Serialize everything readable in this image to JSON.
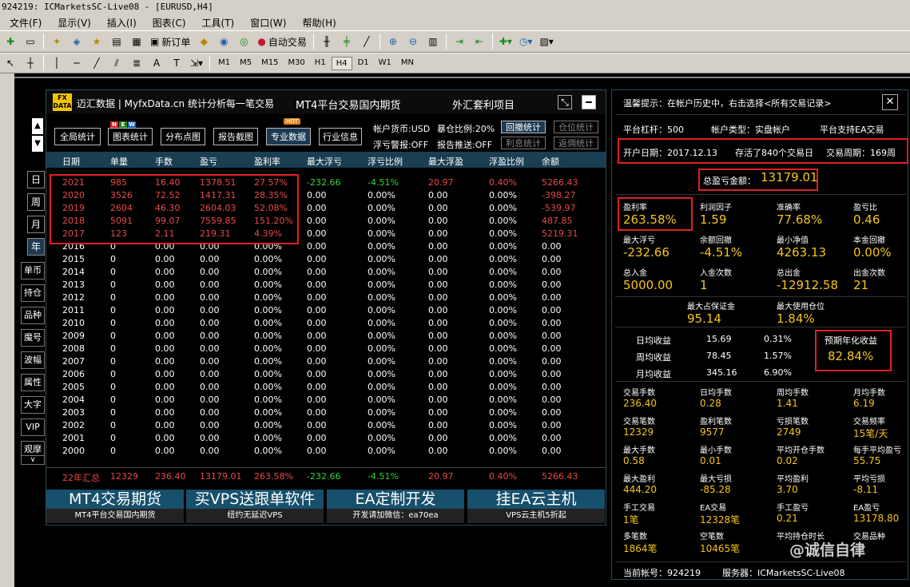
{
  "window": {
    "title": "924219: ICMarketsSC-Live08 - [EURUSD,H4]"
  },
  "menu": [
    "文件(F)",
    "显示(V)",
    "插入(I)",
    "图表(C)",
    "工具(T)",
    "窗口(W)",
    "帮助(H)"
  ],
  "toolbar": {
    "new_order": "新订单",
    "auto_trade": "自动交易",
    "timeframes": [
      "M1",
      "M5",
      "M15",
      "M30",
      "H1",
      "H4",
      "D1",
      "W1",
      "MN"
    ],
    "active_timeframe": "H4"
  },
  "panel": {
    "logo": "FX DATA",
    "brand": "迈汇数据 | MyfxData.cn  统计分析每一笔交易",
    "ad1": "MT4平台交易国内期货",
    "ad2": "外汇套利项目",
    "buttons": [
      "全局统计",
      "图表统计",
      "分布点图",
      "报告截图",
      "专业数据",
      "行业信息"
    ],
    "badge_new": [
      "N",
      "E",
      "W"
    ],
    "badge_hot": "HOT",
    "info": {
      "currency": "帐户货币:USD",
      "exposure": "暴仓比例:20%",
      "float_alert": "浮亏警报:OFF",
      "report_push": "报告推送:OFF"
    },
    "side_buttons": [
      "回撤统计",
      "仓位统计",
      "利息统计",
      "返佣统计"
    ],
    "period_buttons": [
      "日",
      "周",
      "月",
      "年"
    ],
    "active_period": "年",
    "nav_buttons": [
      "单币",
      "持仓",
      "品种",
      "魔号",
      "波幅",
      "属性",
      "大字",
      "VIP",
      "观摩",
      "∨"
    ],
    "headers": [
      "日期",
      "单量",
      "手数",
      "盈亏",
      "盈利率",
      "最大浮亏",
      "浮亏比例",
      "最大浮盈",
      "浮盈比例",
      "余额"
    ],
    "rows": [
      [
        "2021",
        "985",
        "16.40",
        "1378.51",
        "27.57%",
        "-232.66",
        "-4.51%",
        "20.97",
        "0.40%",
        "5266.43"
      ],
      [
        "2020",
        "3526",
        "72.52",
        "1417.31",
        "28.35%",
        "0.00",
        "0.00%",
        "0.00",
        "0.00%",
        "-398.27"
      ],
      [
        "2019",
        "2604",
        "46.30",
        "2604.03",
        "52.08%",
        "0.00",
        "0.00%",
        "0.00",
        "0.00%",
        "-539.97"
      ],
      [
        "2018",
        "5091",
        "99.07",
        "7559.85",
        "151.20%",
        "0.00",
        "0.00%",
        "0.00",
        "0.00%",
        "487.85"
      ],
      [
        "2017",
        "123",
        "2.11",
        "219.31",
        "4.39%",
        "0.00",
        "0.00%",
        "0.00",
        "0.00%",
        "5219.31"
      ],
      [
        "2016",
        "0",
        "0.00",
        "0.00",
        "0.00%",
        "0.00",
        "0.00%",
        "0.00",
        "0.00%",
        "0.00"
      ],
      [
        "2015",
        "0",
        "0.00",
        "0.00",
        "0.00%",
        "0.00",
        "0.00%",
        "0.00",
        "0.00%",
        "0.00"
      ],
      [
        "2014",
        "0",
        "0.00",
        "0.00",
        "0.00%",
        "0.00",
        "0.00%",
        "0.00",
        "0.00%",
        "0.00"
      ],
      [
        "2013",
        "0",
        "0.00",
        "0.00",
        "0.00%",
        "0.00",
        "0.00%",
        "0.00",
        "0.00%",
        "0.00"
      ],
      [
        "2012",
        "0",
        "0.00",
        "0.00",
        "0.00%",
        "0.00",
        "0.00%",
        "0.00",
        "0.00%",
        "0.00"
      ],
      [
        "2011",
        "0",
        "0.00",
        "0.00",
        "0.00%",
        "0.00",
        "0.00%",
        "0.00",
        "0.00%",
        "0.00"
      ],
      [
        "2010",
        "0",
        "0.00",
        "0.00",
        "0.00%",
        "0.00",
        "0.00%",
        "0.00",
        "0.00%",
        "0.00"
      ],
      [
        "2009",
        "0",
        "0.00",
        "0.00",
        "0.00%",
        "0.00",
        "0.00%",
        "0.00",
        "0.00%",
        "0.00"
      ],
      [
        "2008",
        "0",
        "0.00",
        "0.00",
        "0.00%",
        "0.00",
        "0.00%",
        "0.00",
        "0.00%",
        "0.00"
      ],
      [
        "2007",
        "0",
        "0.00",
        "0.00",
        "0.00%",
        "0.00",
        "0.00%",
        "0.00",
        "0.00%",
        "0.00"
      ],
      [
        "2006",
        "0",
        "0.00",
        "0.00",
        "0.00%",
        "0.00",
        "0.00%",
        "0.00",
        "0.00%",
        "0.00"
      ],
      [
        "2005",
        "0",
        "0.00",
        "0.00",
        "0.00%",
        "0.00",
        "0.00%",
        "0.00",
        "0.00%",
        "0.00"
      ],
      [
        "2004",
        "0",
        "0.00",
        "0.00",
        "0.00%",
        "0.00",
        "0.00%",
        "0.00",
        "0.00%",
        "0.00"
      ],
      [
        "2003",
        "0",
        "0.00",
        "0.00",
        "0.00%",
        "0.00",
        "0.00%",
        "0.00",
        "0.00%",
        "0.00"
      ],
      [
        "2002",
        "0",
        "0.00",
        "0.00",
        "0.00%",
        "0.00",
        "0.00%",
        "0.00",
        "0.00%",
        "0.00"
      ],
      [
        "2001",
        "0",
        "0.00",
        "0.00",
        "0.00%",
        "0.00",
        "0.00%",
        "0.00",
        "0.00%",
        "0.00"
      ],
      [
        "2000",
        "0",
        "0.00",
        "0.00",
        "0.00%",
        "0.00",
        "0.00%",
        "0.00",
        "0.00%",
        "0.00"
      ]
    ],
    "summary": [
      "22年汇总",
      "12329",
      "236.40",
      "13179.01",
      "263.58%",
      "-232.66",
      "-4.51%",
      "20.97",
      "0.40%",
      "5266.43"
    ],
    "banners": [
      {
        "big": "MT4交易期货",
        "small": "MT4平台交易国内期货"
      },
      {
        "big": "买VPS送跟单软件",
        "small": "纽约无延迟VPS"
      },
      {
        "big": "EA定制开发",
        "small": "开发请加微信：ea70ea"
      },
      {
        "big": "挂EA云主机",
        "small": "VPS云主机5折起"
      }
    ]
  },
  "right": {
    "hint": "温馨提示：在帐户历史中，右击选择<所有交易记录>",
    "leverage": "平台杠杆：500",
    "account_type": "帐户类型：实盘帐户",
    "ea_support": "平台支持EA交易",
    "open_date": "开户日期：2017.12.13",
    "survive": "存活了840个交易日",
    "cycle": "交易周期：169周",
    "total_label": "总盈亏金额：",
    "total_value": "13179.01",
    "stats1": [
      {
        "k": "盈利率",
        "v": "263.58%"
      },
      {
        "k": "利润因子",
        "v": "1.59"
      },
      {
        "k": "准确率",
        "v": "77.68%"
      },
      {
        "k": "盈亏比",
        "v": "0.46"
      },
      {
        "k": "最大浮亏",
        "v": "-232.66"
      },
      {
        "k": "余额回撤",
        "v": "-4.51%"
      },
      {
        "k": "最小净值",
        "v": "4263.13"
      },
      {
        "k": "本金回撤",
        "v": "0.00%"
      },
      {
        "k": "总入金",
        "v": "5000.00"
      },
      {
        "k": "入金次数",
        "v": "1"
      },
      {
        "k": "总出金",
        "v": "-12912.58"
      },
      {
        "k": "出金次数",
        "v": "21"
      }
    ],
    "margin": [
      {
        "k": "最大占保证金",
        "v": "95.14"
      },
      {
        "k": "最大使用仓位",
        "v": "1.84%"
      }
    ],
    "avg": [
      [
        "日均收益",
        "15.69",
        "0.31%"
      ],
      [
        "周均收益",
        "78.45",
        "1.57%"
      ],
      [
        "月均收益",
        "345.16",
        "6.90%"
      ]
    ],
    "annual_label": "预期年化收益",
    "annual_value": "82.84%",
    "stats2": [
      {
        "k": "交易手数",
        "v": "236.40"
      },
      {
        "k": "日均手数",
        "v": "0.28"
      },
      {
        "k": "周均手数",
        "v": "1.41"
      },
      {
        "k": "月均手数",
        "v": "6.19"
      },
      {
        "k": "交易笔数",
        "v": "12329"
      },
      {
        "k": "盈利笔数",
        "v": "9577"
      },
      {
        "k": "亏损笔数",
        "v": "2749"
      },
      {
        "k": "交易频率",
        "v": "15笔/天"
      },
      {
        "k": "最大手数",
        "v": "0.58"
      },
      {
        "k": "最小手数",
        "v": "0.01"
      },
      {
        "k": "平均开仓手数",
        "v": "0.02"
      },
      {
        "k": "每手平均盈亏",
        "v": "55.75"
      },
      {
        "k": "最大盈利",
        "v": "444.20"
      },
      {
        "k": "最大亏损",
        "v": "-85.28"
      },
      {
        "k": "平均盈利",
        "v": "3.70"
      },
      {
        "k": "平均亏损",
        "v": "-8.11"
      },
      {
        "k": "手工交易",
        "v": "1笔"
      },
      {
        "k": "EA交易",
        "v": "12328笔"
      },
      {
        "k": "手工盈亏",
        "v": "0.21"
      },
      {
        "k": "EA盈亏",
        "v": "13178.80"
      },
      {
        "k": "多笔数",
        "v": "1864笔"
      },
      {
        "k": "空笔数",
        "v": "10465笔"
      },
      {
        "k": "平均持仓时长",
        "v": ""
      },
      {
        "k": "交易品种",
        "v": ""
      }
    ],
    "account": "当前帐号：924219",
    "server": "服务器：ICMarketsSC-Live08"
  },
  "watermark": "@诚信自律",
  "colors": {
    "red": "#e02020",
    "yellow": "#f5c518",
    "green": "#3ad13a",
    "header_bg": "#1a3e52"
  }
}
